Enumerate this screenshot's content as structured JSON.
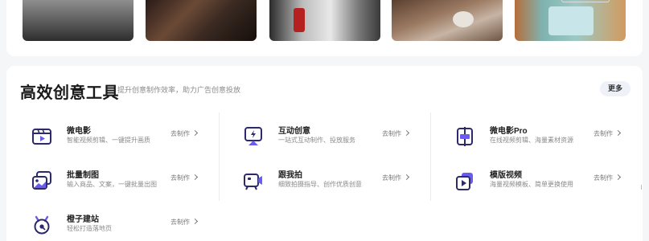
{
  "section": {
    "title": "高效创意工具",
    "subtitle": "提升创意制作效率，助力广告创意投放",
    "more_label": "更多"
  },
  "thumbnails": [
    {
      "name": "video-thumbnail-1"
    },
    {
      "name": "video-thumbnail-2"
    },
    {
      "name": "video-thumbnail-3"
    },
    {
      "name": "video-thumbnail-4"
    },
    {
      "name": "video-thumbnail-5"
    }
  ],
  "tools": [
    {
      "name": "微电影",
      "desc": "智能视频剪辑、一键提升画质",
      "action": "去制作",
      "icon": "video-play-icon"
    },
    {
      "name": "互动创意",
      "desc": "一站式互动制作、投放服务",
      "action": "去制作",
      "icon": "interactive-screen-icon"
    },
    {
      "name": "微电影Pro",
      "desc": "在线视频剪辑、海量素材资源",
      "action": "去制作",
      "icon": "video-split-icon"
    },
    {
      "name": "批量制图",
      "desc": "输入商品、文案，一键批量出图",
      "action": "去制作",
      "icon": "image-batch-icon"
    },
    {
      "name": "跟我拍",
      "desc": "细致拍摄指导、创作优质创意",
      "action": "去制作",
      "icon": "camera-tv-icon"
    },
    {
      "name": "模版视频",
      "desc": "海量视频模板、简单更换使用",
      "action": "去制作",
      "icon": "template-video-icon"
    },
    {
      "name": "橙子建站",
      "desc": "轻松打造落地页",
      "action": "去制作",
      "icon": "site-builder-icon"
    }
  ],
  "colors": {
    "accent": "#4b3fc9",
    "accent_light": "#8b84e6",
    "card_bg": "#ffffff",
    "page_bg": "#f5f6f8"
  }
}
